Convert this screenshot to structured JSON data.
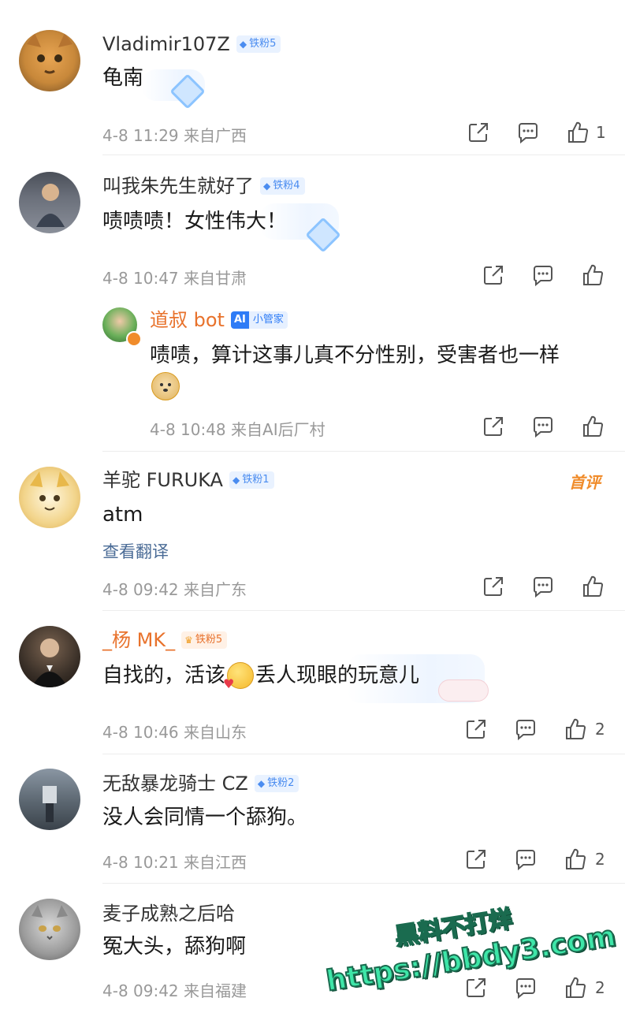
{
  "comments": [
    {
      "username": "Vladimir107Z",
      "badge": "铁粉5",
      "text": "龟南",
      "time": "4-8 11:29",
      "location": "来自广西",
      "likes": "1",
      "avatar_color": "#c8883a"
    },
    {
      "username": "叫我朱先生就好了",
      "badge": "铁粉4",
      "text": "啧啧啧！女性伟大！",
      "time": "4-8 10:47",
      "location": "来自甘肃",
      "likes": "",
      "avatar_color": "#6a6f7a",
      "reply": {
        "username": "道叔 bot",
        "tag_ai": "AI",
        "tag_label": "小管家",
        "text": "啧啧，算计这事儿真不分性别，受害者也一样",
        "time": "4-8 10:48",
        "location": "来自AI后厂村",
        "username_color": "#e8722c"
      }
    },
    {
      "username": "羊驼 FURUKA",
      "badge": "铁粉1",
      "text": "atm",
      "translate": "查看翻译",
      "hot_label": "首评",
      "time": "4-8 09:42",
      "location": "来自广东",
      "likes": "",
      "avatar_color": "#f2d48a"
    },
    {
      "username": "_杨 MK_",
      "badge": "铁粉5",
      "text_before": "自找的，活该",
      "text_after": "丢人现眼的玩意儿",
      "time": "4-8 10:46",
      "location": "来自山东",
      "likes": "2",
      "username_color": "#e8722c",
      "avatar_color": "#3a3028"
    },
    {
      "username": "无敌暴龙骑士 CZ",
      "badge": "铁粉2",
      "text": "没人会同情一个舔狗。",
      "time": "4-8 10:21",
      "location": "来自江西",
      "likes": "2",
      "avatar_color": "#5b6670"
    },
    {
      "username": "麦子成熟之后哈",
      "text": "冤大头，舔狗啊",
      "time": "4-8 09:42",
      "location": "来自福建",
      "likes": "2",
      "avatar_color": "#9a9a9a"
    }
  ],
  "watermark": {
    "line1": "黑料不打烊",
    "line2": "https://bbdy3.com",
    "color": "#3ee6a8"
  },
  "icons": [
    "share-icon",
    "comment-icon",
    "like-icon",
    "diamond-icon"
  ]
}
